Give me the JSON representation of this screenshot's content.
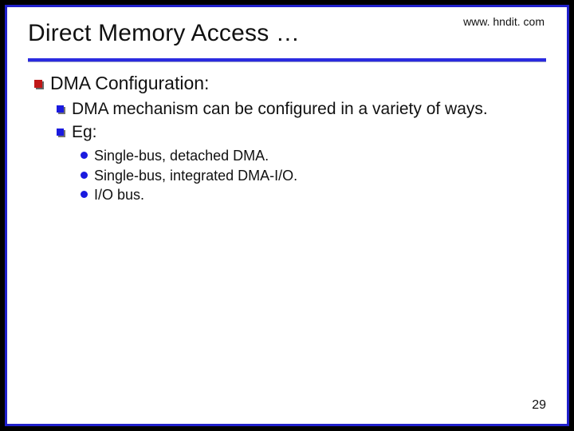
{
  "header": {
    "title": "Direct Memory Access …",
    "url": "www. hndit. com"
  },
  "content": {
    "heading": "DMA Configuration:",
    "points": {
      "p1": "DMA mechanism can be configured in a variety of ways.",
      "p2": "Eg:"
    },
    "sub": {
      "s1": "Single-bus, detached DMA.",
      "s2": "Single-bus, integrated DMA-I/O.",
      "s3": "I/O bus."
    }
  },
  "page_number": "29"
}
